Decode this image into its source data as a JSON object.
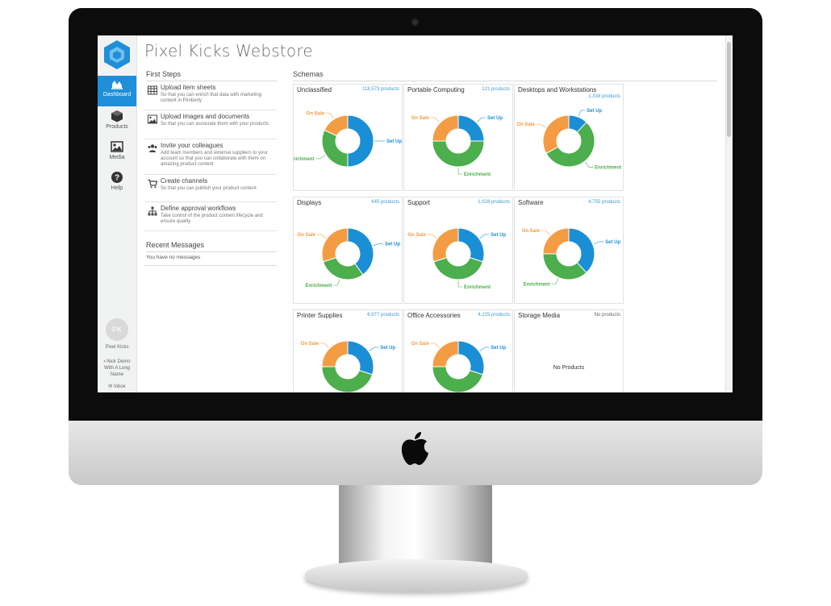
{
  "colors": {
    "setup": "#1a8fd6",
    "enrichment": "#4cae4c",
    "onsale": "#f39c43",
    "accent": "#1e8fd8"
  },
  "app": {
    "title": "Pixel Kicks Webstore"
  },
  "sidebar": {
    "items": [
      {
        "label": "Dashboard",
        "icon": "chart-icon",
        "active": true
      },
      {
        "label": "Products",
        "icon": "cube-icon"
      },
      {
        "label": "Media",
        "icon": "image-icon"
      },
      {
        "label": "Help",
        "icon": "help-icon"
      }
    ],
    "avatar_initials": "PK",
    "account_name": "Pixel Kicks",
    "user_name": "Nick Demo With A Long Name",
    "inbox_label": "Inbox"
  },
  "first_steps": {
    "heading": "First Steps",
    "items": [
      {
        "title": "Upload item sheets",
        "desc": "So that you can enrich that data with marketing content in Pimberly",
        "icon": "table-icon"
      },
      {
        "title": "Upload images and documents",
        "desc": "So that you can associate them with your products",
        "icon": "image-icon"
      },
      {
        "title": "Invite your colleagues",
        "desc": "Add team members and external suppliers to your account so that you can collaborate with them on amazing product content",
        "icon": "users-icon"
      },
      {
        "title": "Create channels",
        "desc": "So that you can publish your product content",
        "icon": "cart-icon"
      },
      {
        "title": "Define approval workflows",
        "desc": "Take control of the product content lifecycle and ensure quality",
        "icon": "sitemap-icon"
      }
    ]
  },
  "recent_messages": {
    "heading": "Recent Messages",
    "empty": "You have no messages"
  },
  "schemas": {
    "heading": "Schemas",
    "label_setup": "Set Up",
    "label_enrichment": "Enrichment",
    "label_onsale": "On Sale",
    "no_products_text": "No Products",
    "cards": [
      {
        "name": "Unclassified",
        "count": "118,573 products",
        "setup": 0.5,
        "enrichment": 0.32,
        "onsale": 0.18
      },
      {
        "name": "Portable Computing",
        "count": "121 products",
        "setup": 0.25,
        "enrichment": 0.5,
        "onsale": 0.25
      },
      {
        "name": "Desktops and Workstations",
        "count": "1,338 products",
        "setup": 0.12,
        "enrichment": 0.55,
        "onsale": 0.33
      },
      {
        "name": "Displays",
        "count": "645 products",
        "setup": 0.4,
        "enrichment": 0.3,
        "onsale": 0.3
      },
      {
        "name": "Support",
        "count": "1,928 products",
        "setup": 0.3,
        "enrichment": 0.4,
        "onsale": 0.3
      },
      {
        "name": "Software",
        "count": "4,755 products",
        "setup": 0.38,
        "enrichment": 0.37,
        "onsale": 0.25
      },
      {
        "name": "Printer Supplies",
        "count": "6,977 products",
        "setup": 0.3,
        "enrichment": 0.45,
        "onsale": 0.25
      },
      {
        "name": "Office Accessories",
        "count": "4,225 products",
        "setup": 0.3,
        "enrichment": 0.45,
        "onsale": 0.25
      },
      {
        "name": "Storage Media",
        "count": "No products",
        "empty": true
      }
    ]
  }
}
